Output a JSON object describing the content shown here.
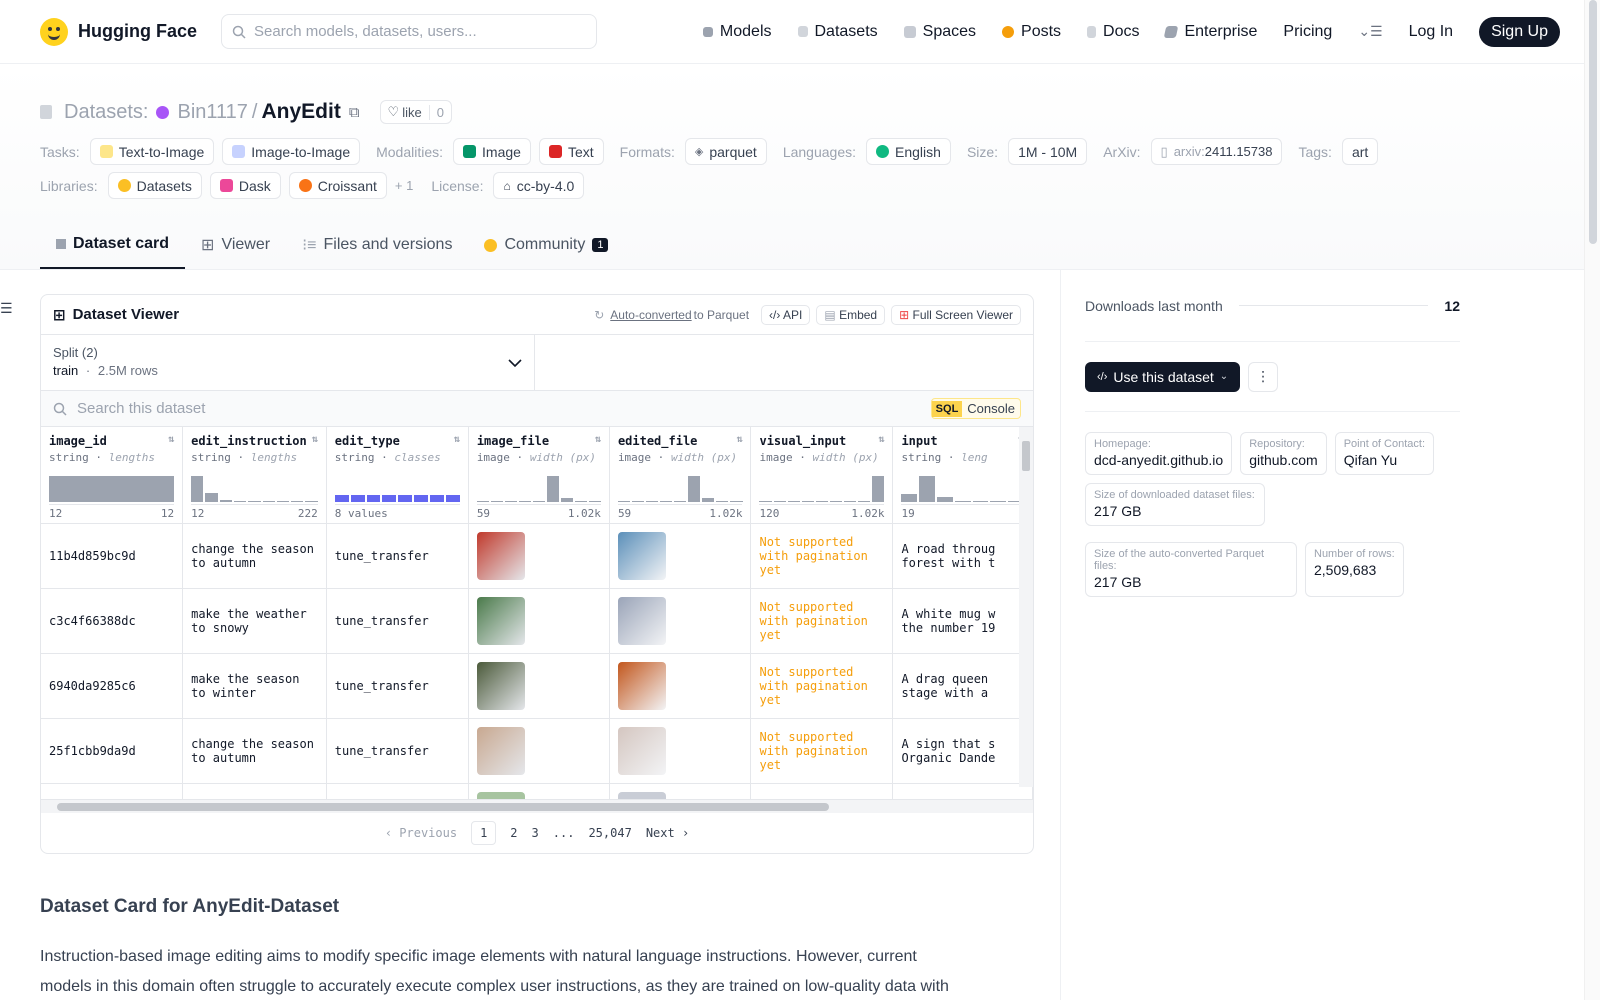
{
  "nav": {
    "brand": "Hugging Face",
    "search_placeholder": "Search models, datasets, users...",
    "links": [
      "Models",
      "Datasets",
      "Spaces",
      "Posts",
      "Docs",
      "Enterprise",
      "Pricing"
    ],
    "login": "Log In",
    "signup": "Sign Up"
  },
  "repo": {
    "prefix": "Datasets:",
    "owner": "Bin1117",
    "sep": "/",
    "name": "AnyEdit",
    "like_label": "like",
    "like_count": "0"
  },
  "meta_tags": {
    "tasks_label": "Tasks:",
    "tasks": [
      "Text-to-Image",
      "Image-to-Image"
    ],
    "modalities_label": "Modalities:",
    "modalities": [
      "Image",
      "Text"
    ],
    "formats_label": "Formats:",
    "format": "parquet",
    "languages_label": "Languages:",
    "language": "English",
    "size_label": "Size:",
    "size": "1M - 10M",
    "arxiv_label": "ArXiv:",
    "arxiv_prefix": "arxiv:",
    "arxiv_id": "2411.15738",
    "tags_label": "Tags:",
    "tag": "art",
    "libraries_label": "Libraries:",
    "libraries": [
      "Datasets",
      "Dask",
      "Croissant"
    ],
    "libraries_more": "+ 1",
    "license_label": "License:",
    "license": "cc-by-4.0"
  },
  "tabs": [
    {
      "label": "Dataset card"
    },
    {
      "label": "Viewer"
    },
    {
      "label": "Files and versions"
    },
    {
      "label": "Community",
      "badge": "1"
    }
  ],
  "viewer": {
    "title": "Dataset Viewer",
    "auto_converted": "Auto-converted",
    "to_parquet": "to Parquet",
    "api": "API",
    "embed": "Embed",
    "fullscreen": "Full Screen Viewer",
    "split_label": "Split (2)",
    "split_value": "train",
    "split_dot": "·",
    "split_rows": "2.5M rows",
    "search_placeholder": "Search this dataset",
    "sql": "SQL",
    "console": "Console",
    "columns": [
      {
        "name": "image_id",
        "type": "string",
        "stat": "lengths",
        "min": "12",
        "max": "12",
        "hist": [
          1.0
        ],
        "kind": "num"
      },
      {
        "name": "edit_instruction",
        "type": "string",
        "stat": "lengths",
        "min": "12",
        "max": "222",
        "hist": [
          1.0,
          0.35,
          0.06,
          0.04,
          0.03,
          0.03,
          0.03,
          0.03,
          0.03
        ],
        "kind": "num"
      },
      {
        "name": "edit_type",
        "type": "string",
        "stat": "classes",
        "min": "8 values",
        "max": "",
        "hist": [
          1,
          1,
          1,
          1,
          1,
          1,
          1,
          1
        ],
        "kind": "cls"
      },
      {
        "name": "image_file",
        "type": "image",
        "stat": "width (px)",
        "min": "59",
        "max": "1.02k",
        "hist": [
          0.03,
          0.03,
          0.03,
          0.03,
          0.03,
          1.0,
          0.15,
          0.0,
          0.03
        ],
        "kind": "num"
      },
      {
        "name": "edited_file",
        "type": "image",
        "stat": "width (px)",
        "min": "59",
        "max": "1.02k",
        "hist": [
          0.03,
          0.03,
          0.03,
          0.03,
          0.03,
          1.0,
          0.15,
          0.0,
          0.03
        ],
        "kind": "num"
      },
      {
        "name": "visual_input",
        "type": "image",
        "stat": "width (px)",
        "min": "120",
        "max": "1.02k",
        "hist": [
          0.03,
          0.03,
          0.03,
          0.03,
          0.03,
          0.0,
          0.0,
          0.0,
          1.0
        ],
        "kind": "num"
      },
      {
        "name": "input",
        "type": "string",
        "stat": "leng",
        "min": "19",
        "max": "",
        "hist": [
          0.3,
          1.0,
          0.2,
          0.05,
          0.05,
          0.03,
          0.03
        ],
        "kind": "num"
      }
    ],
    "rows": [
      {
        "image_id": "11b4d859bc9d",
        "edit_instruction": "change the season to autumn",
        "edit_type": "tune_transfer",
        "img_a": "#c0392b",
        "img_b": "#5b8fb9",
        "visual_input": "Not supported with pagination yet",
        "input": "A road throug forest with t"
      },
      {
        "image_id": "c3c4f66388dc",
        "edit_instruction": "make the weather to snowy",
        "edit_type": "tune_transfer",
        "img_a": "#4a7a4a",
        "img_b": "#9aa4b8",
        "visual_input": "Not supported with pagination yet",
        "input": "A white mug w the number 19"
      },
      {
        "image_id": "6940da9285c6",
        "edit_instruction": "make the season to winter",
        "edit_type": "tune_transfer",
        "img_a": "#4b5a3a",
        "img_b": "#c2561c",
        "visual_input": "Not supported with pagination yet",
        "input": "A drag queen stage with a"
      },
      {
        "image_id": "25f1cbb9da9d",
        "edit_instruction": "change the season to autumn",
        "edit_type": "tune_transfer",
        "img_a": "#c8a890",
        "img_b": "#d4c6c0",
        "visual_input": "Not supported with pagination yet",
        "input": "A sign that s Organic Dande"
      }
    ],
    "pager": {
      "prev": "Previous",
      "pages": [
        "1",
        "2",
        "3",
        "...",
        "25,047"
      ],
      "next": "Next"
    }
  },
  "card": {
    "title": "Dataset Card for AnyEdit-Dataset",
    "text": "Instruction-based image editing aims to modify specific image elements with natural language instructions. However, current models in this domain often struggle to accurately execute complex user instructions, as they are trained on low-quality data with"
  },
  "sidebar": {
    "downloads_label": "Downloads last month",
    "downloads": "12",
    "use_button": "Use this dataset",
    "meta": [
      {
        "k": "Homepage:",
        "v": "dcd-anyedit.github.io"
      },
      {
        "k": "Repository:",
        "v": "github.com"
      },
      {
        "k": "Point of Contact:",
        "v": "Qifan Yu"
      },
      {
        "k": "Size of downloaded dataset files:",
        "v": "217 GB"
      },
      {
        "k": "Size of the auto-converted Parquet files:",
        "v": "217 GB"
      },
      {
        "k": "Number of rows:",
        "v": "2,509,683"
      }
    ]
  },
  "colors": {
    "accent": "#111827",
    "warning": "#f59e0b",
    "class_bar": "#6366f1"
  }
}
